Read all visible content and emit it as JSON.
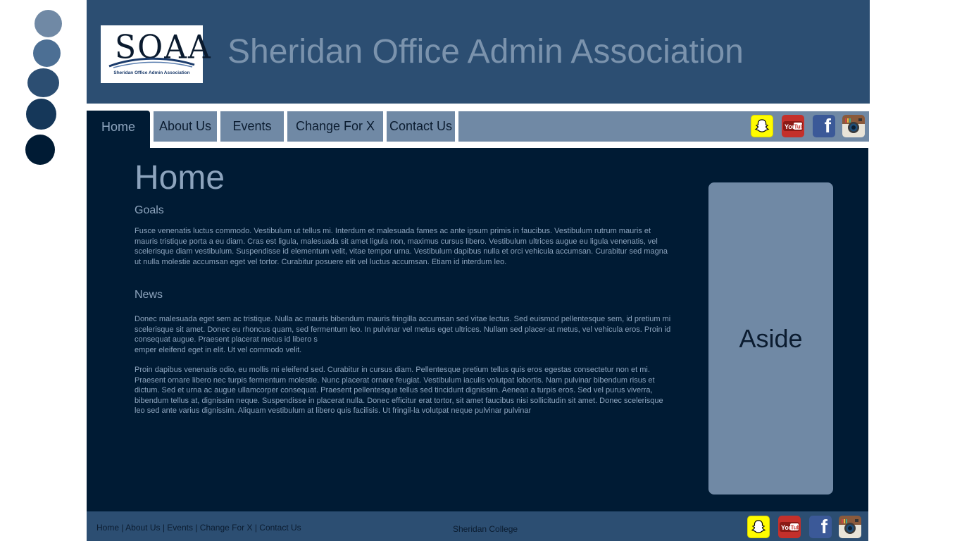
{
  "header": {
    "logo_text": "SOAA",
    "logo_caption": "Sheridan Office Admin Association",
    "title": "Sheridan Office Admin Association"
  },
  "nav": {
    "tabs": [
      {
        "label": "Home",
        "active": true
      },
      {
        "label": "About Us"
      },
      {
        "label": "Events"
      },
      {
        "label": "Change For X"
      },
      {
        "label": "Contact Us"
      }
    ],
    "social_icons": [
      "snapchat-icon",
      "youtube-icon",
      "facebook-icon",
      "instagram-icon"
    ]
  },
  "main": {
    "heading": "Home",
    "goals_heading": "Goals",
    "goals_text": "Fusce venenatis luctus commodo. Vestibulum ut tellus mi. Interdum et malesuada fames ac ante ipsum primis in faucibus. Vestibulum rutrum mauris et mauris tristique porta a eu diam. Cras est ligula, malesuada sit amet ligula non, maximus cursus libero. Vestibulum ultrices augue eu ligula venenatis, vel scelerisque diam vestibulum. Suspendisse id elementum velit, vitae tempor urna. Vestibulum dapibus nulla et orci vehicula accumsan. Curabitur sed magna ut nulla molestie accumsan eget vel tortor. Curabitur posuere elit vel luctus accumsan. Etiam id interdum leo.",
    "news_heading": "News",
    "news_text_1a": "Donec malesuada eget sem ac tristique. Nulla ac mauris bibendum mauris fringilla accumsan sed vitae lectus. Sed euismod pellentesque sem, id pretium mi scelerisque sit amet. Donec eu rhoncus quam, sed fermentum leo. In pulvinar vel metus eget ultrices. Nullam sed placer-at metus, vel vehicula eros. Proin id consequat augue. Praesent placerat metus id libero s",
    "news_text_1b": "emper eleifend eget in elit. Ut vel commodo velit.",
    "news_text_2": "Proin dapibus venenatis odio, eu mollis mi eleifend sed. Curabitur in cursus diam. Pellentesque pretium tellus quis eros egestas consectetur non et mi. Praesent ornare libero nec turpis fermentum molestie. Nunc placerat ornare feugiat. Vestibulum iaculis volutpat lobortis. Nam pulvinar bibendum risus et dictum. Sed et urna ac augue ullamcorper consequat. Praesent pellentesque tellus sed tincidunt dignissim. Aenean a turpis eros. Sed vel purus viverra, bibendum tellus at, dignissim neque. Suspendisse in placerat nulla. Donec efficitur erat tortor, sit amet faucibus nisi sollicitudin sit amet. Donec scelerisque leo sed ante varius dignissim. Aliquam vestibulum at libero quis facilisis. Ut fringil-la volutpat neque pulvinar pulvinar",
    "aside_label": "Aside"
  },
  "footer": {
    "links": [
      "Home",
      "About Us",
      "Events",
      "Change For X",
      "Contact Us"
    ],
    "separator": " | ",
    "college": "Sheridan College"
  },
  "colors": {
    "header_bg": "#2c4e72",
    "nav_tab_bg": "#7089a5",
    "main_bg": "#001b34",
    "text_light": "#8da4bd",
    "palette": [
      "#7089a5",
      "#4c6f94",
      "#2c4e72",
      "#153759",
      "#001b34"
    ]
  }
}
